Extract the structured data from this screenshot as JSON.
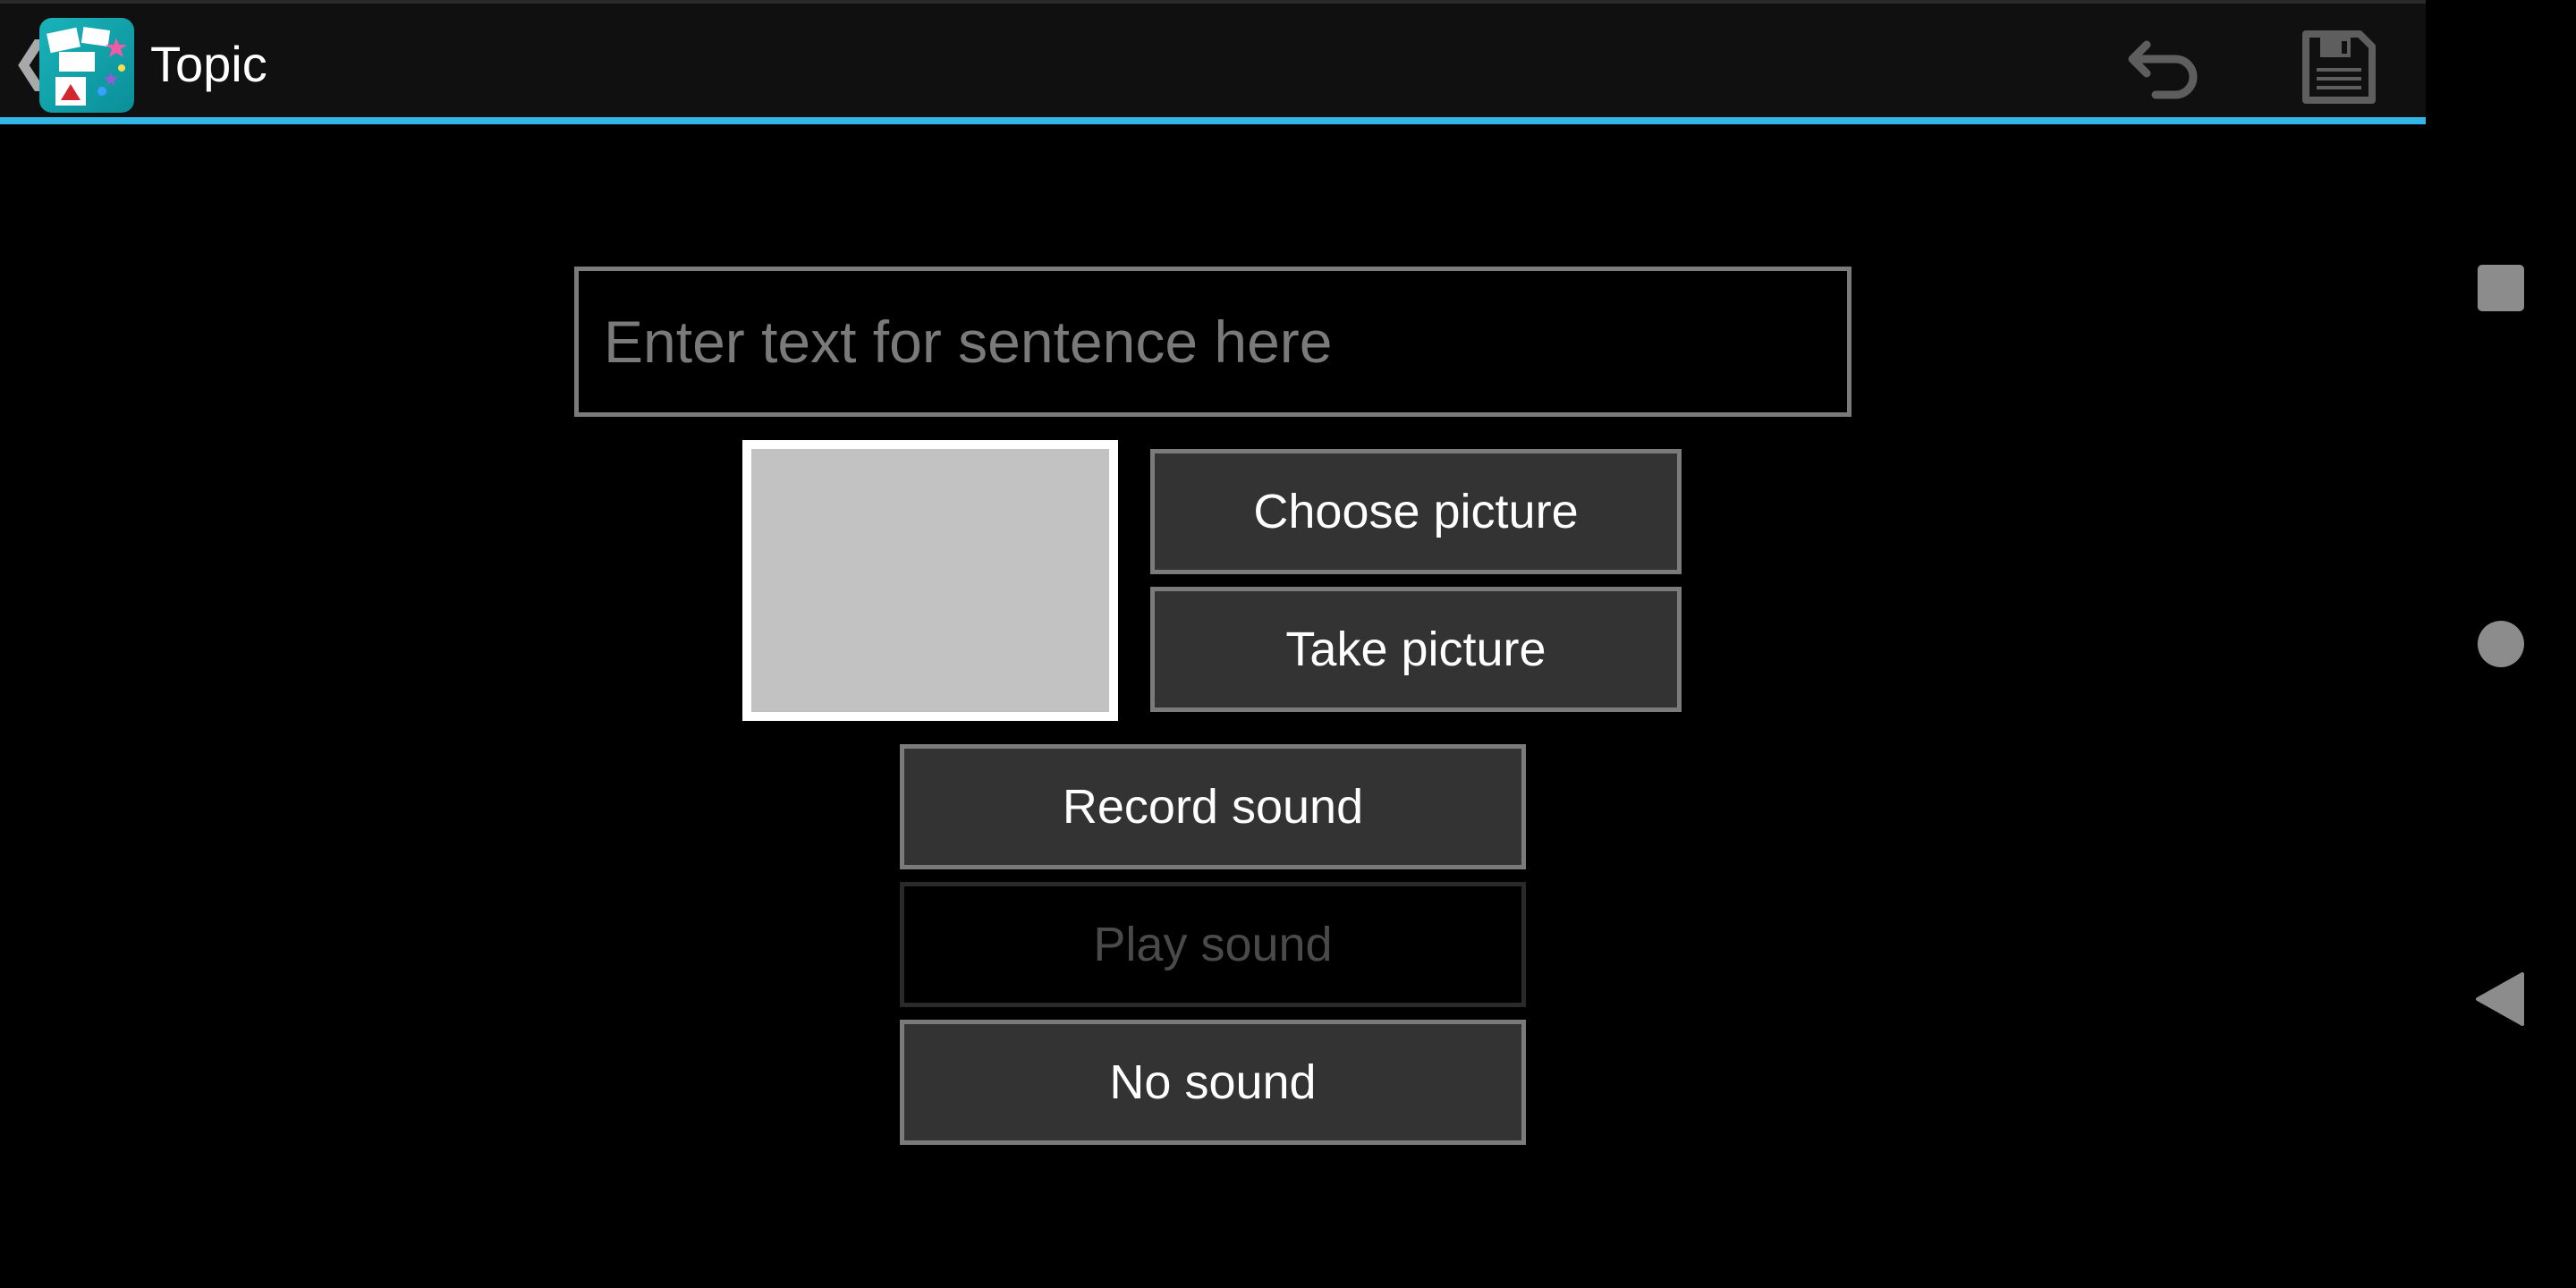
{
  "action_bar": {
    "title": "Topic",
    "up_icon": "chevron-left-icon",
    "app_icon": "app-logo-icon",
    "actions": [
      {
        "icon": "undo-icon",
        "label": "Undo"
      },
      {
        "icon": "floppy-disk-save-icon",
        "label": "Save"
      }
    ],
    "accent_color": "#33b5e5"
  },
  "form": {
    "sentence_placeholder": "Enter text for sentence here",
    "sentence_value": "",
    "choose_picture_label": "Choose picture",
    "take_picture_label": "Take picture",
    "record_sound_label": "Record sound",
    "play_sound_label": "Play sound",
    "no_sound_label": "No sound"
  },
  "nav_bar": {
    "items": [
      "recents-square-icon",
      "home-circle-icon",
      "back-triangle-icon"
    ]
  }
}
